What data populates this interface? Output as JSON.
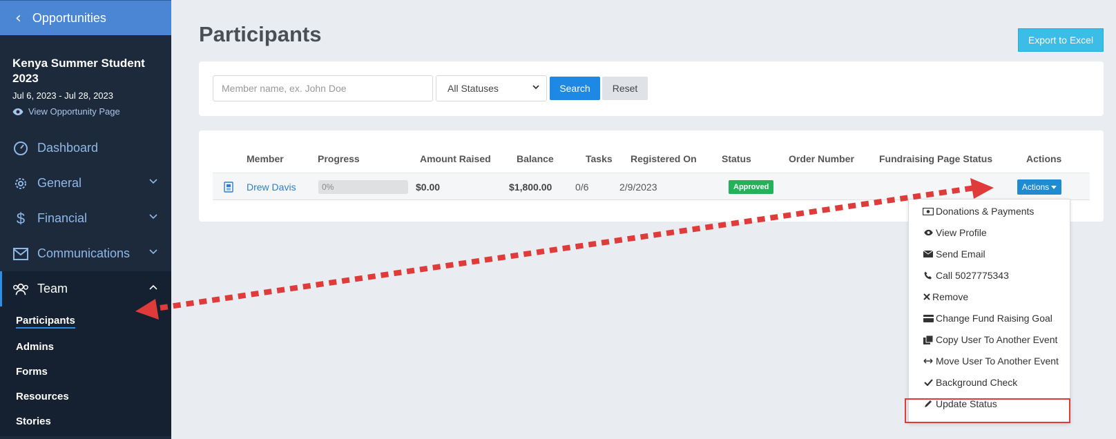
{
  "sidebar": {
    "back_label": "Opportunities",
    "opportunity": {
      "title": "Kenya Summer Student 2023",
      "dates": "Jul 6, 2023 - Jul 28, 2023",
      "view_link": "View Opportunity Page"
    },
    "nav": [
      {
        "label": "Dashboard",
        "icon": "gauge-icon"
      },
      {
        "label": "General",
        "icon": "gear-icon"
      },
      {
        "label": "Financial",
        "icon": "dollar-icon"
      },
      {
        "label": "Communications",
        "icon": "envelope-icon"
      },
      {
        "label": "Team",
        "icon": "team-icon"
      }
    ],
    "team_sub": [
      "Participants",
      "Admins",
      "Forms",
      "Resources",
      "Stories"
    ]
  },
  "page": {
    "title": "Participants",
    "export_label": "Export to Excel"
  },
  "filter": {
    "member_placeholder": "Member name, ex. John Doe",
    "status_selected": "All Statuses",
    "search_label": "Search",
    "reset_label": "Reset"
  },
  "table": {
    "columns": [
      "Member",
      "Progress",
      "Amount Raised",
      "Balance",
      "Tasks",
      "Registered On",
      "Status",
      "Order Number",
      "Fundraising Page Status",
      "Actions"
    ],
    "rows": [
      {
        "member": "Drew Davis",
        "progress": "0%",
        "amount_raised": "$0.00",
        "balance": "$1,800.00",
        "tasks": "0/6",
        "registered_on": "2/9/2023",
        "status": "Approved",
        "order_number": "",
        "fundraising_status": "",
        "actions_label": "Actions"
      }
    ]
  },
  "actions_menu": [
    {
      "label": "Donations & Payments",
      "icon": "money-icon"
    },
    {
      "label": "View Profile",
      "icon": "eye-icon"
    },
    {
      "label": "Send Email",
      "icon": "envelope-icon"
    },
    {
      "label": "Call 5027775343",
      "icon": "phone-icon"
    },
    {
      "label": "Remove",
      "icon": "times-icon"
    },
    {
      "label": "Change Fund Raising Goal",
      "icon": "credit-card-icon"
    },
    {
      "label": "Copy User To Another Event",
      "icon": "copy-icon"
    },
    {
      "label": "Move User To Another Event",
      "icon": "arrows-horizontal-icon"
    },
    {
      "label": "Background Check",
      "icon": "check-icon"
    },
    {
      "label": "Update Status",
      "icon": "pencil-icon"
    }
  ],
  "colors": {
    "accent": "#1e88e5",
    "sidebar_bg": "#1d2a3b",
    "sidebar_header": "#4a86d4",
    "approved": "#22b35a",
    "annotation_red": "#e03b3b"
  }
}
